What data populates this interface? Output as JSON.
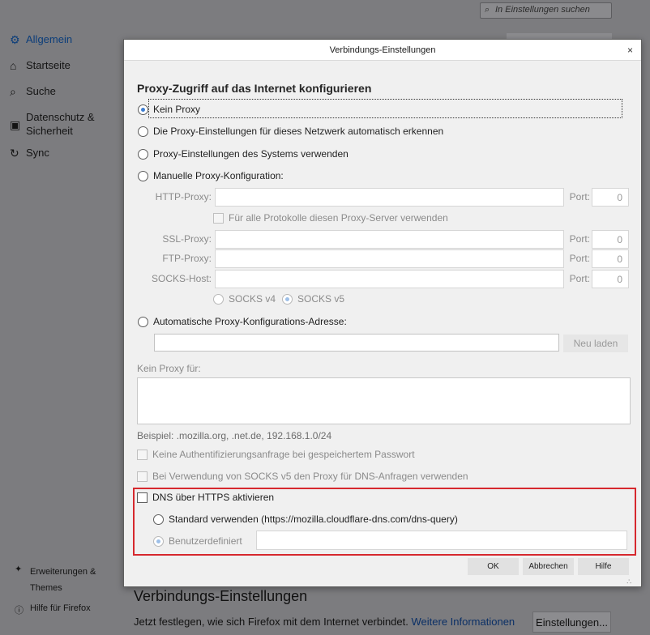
{
  "prefs": {
    "search_placeholder": "In Einstellungen suchen",
    "nav": [
      {
        "icon": "gear-icon",
        "label": "Allgemein"
      },
      {
        "icon": "home-icon",
        "label": "Startseite"
      },
      {
        "icon": "search-icon",
        "label": "Suche"
      },
      {
        "icon": "lock-icon",
        "label": "Datenschutz & Sicherheit"
      },
      {
        "icon": "sync-icon",
        "label": "Sync"
      }
    ],
    "footer": {
      "extensions": "Erweiterungen & Themes",
      "help": "Hilfe für Firefox"
    },
    "connection_heading": "Verbindungs-Einstellungen",
    "connection_desc": "Jetzt festlegen, wie sich Firefox mit dem Internet verbindet.",
    "learn_more": "Weitere Informationen",
    "settings_button": "Einstellungen..."
  },
  "dialog": {
    "title": "Verbindungs-Einstellungen",
    "close_symbol": "×",
    "section_title": "Proxy-Zugriff auf das Internet konfigurieren",
    "options": {
      "no_proxy": "Kein Proxy",
      "auto_detect": "Die Proxy-Einstellungen für dieses Netzwerk automatisch erkennen",
      "system": "Proxy-Einstellungen des Systems verwenden",
      "manual": "Manuelle Proxy-Konfiguration:",
      "auto_url": "Automatische Proxy-Konfigurations-Adresse:"
    },
    "selected_option": "no_proxy",
    "manual": {
      "http_label": "HTTP-Proxy:",
      "ssl_label": "SSL-Proxy:",
      "ftp_label": "FTP-Proxy:",
      "socks_label": "SOCKS-Host:",
      "port_label": "Port:",
      "http_port": "0",
      "ssl_port": "0",
      "ftp_port": "0",
      "socks_port": "0",
      "share_all": "Für alle Protokolle diesen Proxy-Server verwenden",
      "socks_v4": "SOCKS v4",
      "socks_v5": "SOCKS v5",
      "socks_selected": "v5"
    },
    "reload_button": "Neu laden",
    "no_proxy_for_label": "Kein Proxy für:",
    "example_hint": "Beispiel: .mozilla.org, .net.de, 192.168.1.0/24",
    "no_auth_prompt": "Keine Authentifizierungsanfrage bei gespeichertem Passwort",
    "socks_dns": "Bei Verwendung von SOCKS v5 den Proxy für DNS-Anfragen verwenden",
    "doh": {
      "enable_label": "DNS über HTTPS aktivieren",
      "enabled": false,
      "default_label": "Standard verwenden (https://mozilla.cloudflare-dns.com/dns-query)",
      "custom_label": "Benutzerdefiniert",
      "selected": "custom"
    },
    "buttons": {
      "ok": "OK",
      "cancel": "Abbrechen",
      "help": "Hilfe"
    }
  },
  "colors": {
    "highlight_border": "#d6282e",
    "link": "#0a2f66",
    "radio_dot": "#3f7ed1"
  }
}
